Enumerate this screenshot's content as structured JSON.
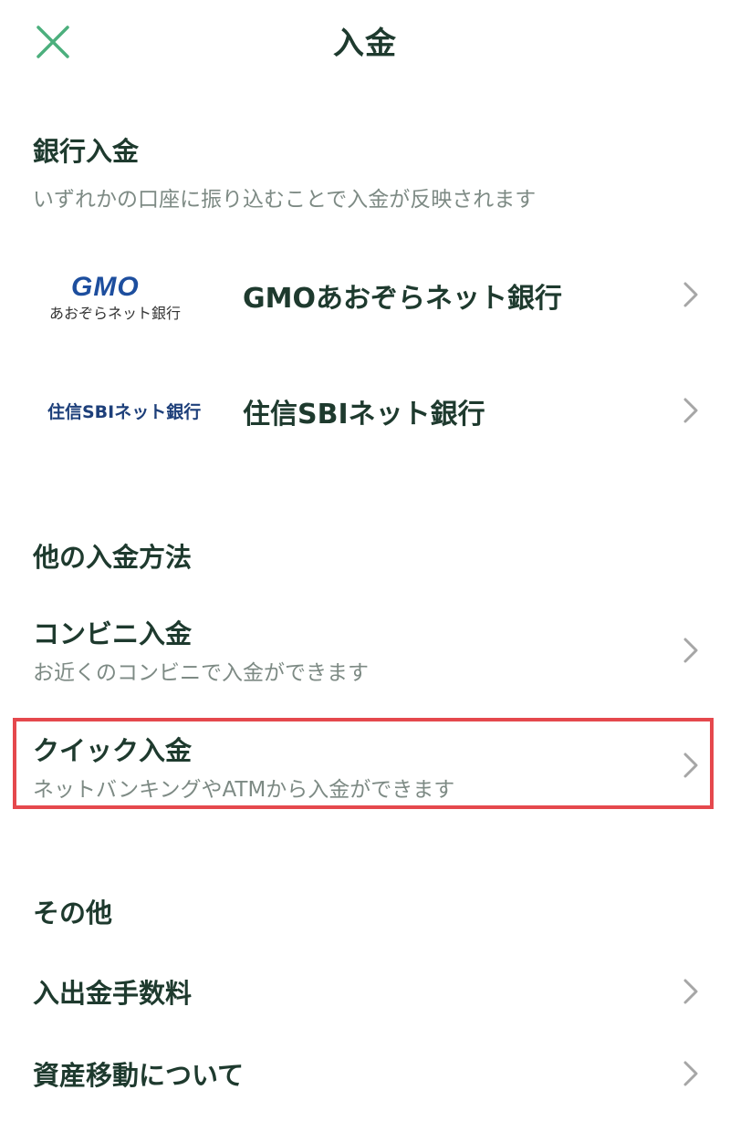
{
  "header": {
    "title": "入金",
    "close_icon": "close-icon",
    "accent_color": "#4caf7d"
  },
  "bank_section": {
    "title": "銀行入金",
    "description": "いずれかの口座に振り込むことで入金が反映されます",
    "banks": [
      {
        "logo_text_top": "GMO",
        "logo_text_bottom": "あおぞらネット銀行",
        "name": "GMOあおぞらネット銀行"
      },
      {
        "logo_text": "住信SBIネット銀行",
        "name": "住信SBIネット銀行"
      }
    ]
  },
  "other_section": {
    "title": "他の入金方法",
    "items": [
      {
        "title": "コンビニ入金",
        "description": "お近くのコンビニで入金ができます"
      },
      {
        "title": "クイック入金",
        "description": "ネットバンキングやATMから入金ができます"
      }
    ]
  },
  "misc_section": {
    "title": "その他",
    "items": [
      {
        "title": "入出金手数料"
      },
      {
        "title": "資産移動について"
      }
    ]
  },
  "colors": {
    "text_primary": "#1e3a2e",
    "text_secondary": "#7d8a84",
    "highlight_border": "#e5484d",
    "chevron": "#a6a6a6"
  }
}
